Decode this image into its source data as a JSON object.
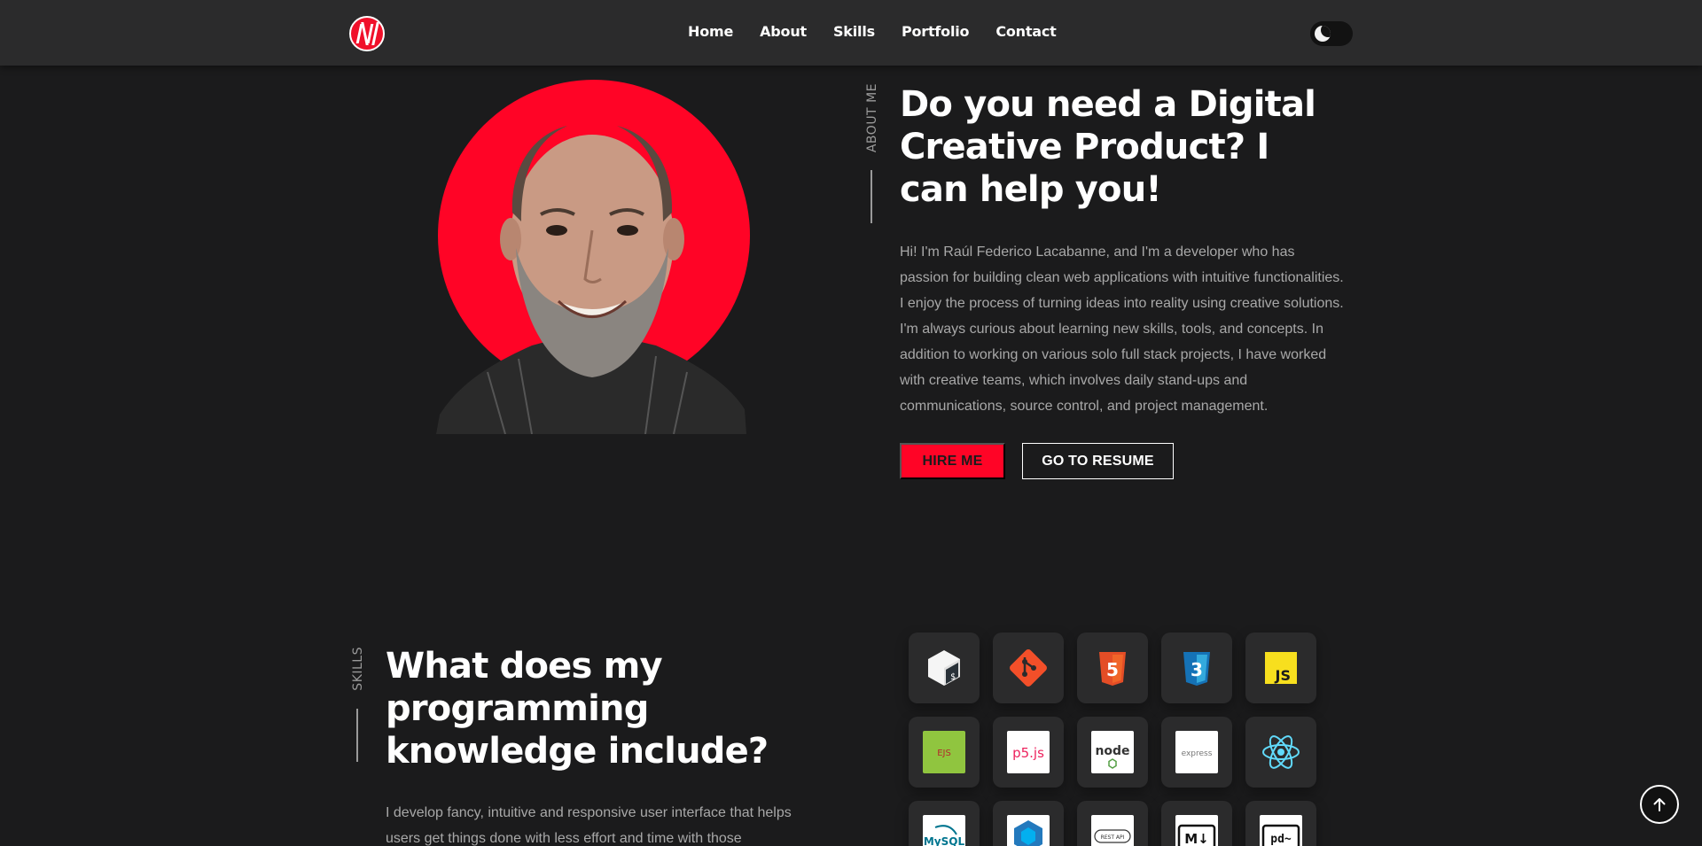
{
  "nav": {
    "links": [
      "Home",
      "About",
      "Skills",
      "Portfolio",
      "Contact"
    ],
    "logo_icon": "knw-logo-icon",
    "theme_toggle_icon": "moon-icon"
  },
  "about": {
    "section_tag": "ABOUT ME",
    "title": "Do you need a Digital Creative Product? I can help you!",
    "text": "Hi! I'm Raúl Federico Lacabanne, and I'm a developer who has passion for building clean web applications with intuitive functionalities. I enjoy the process of turning ideas into reality using creative solutions. I'm always curious about learning new skills, tools, and concepts. In addition to working on various solo full stack projects, I have worked with creative teams, which involves daily stand-ups and communications, source control, and project management.",
    "hire_label": "HIRE ME",
    "resume_label": "GO TO RESUME"
  },
  "skills": {
    "section_tag": "SKILLS",
    "title": "What does my programming knowledge include?",
    "text": "I develop fancy, intuitive and responsive user interface that helps users get things done with less effort and time with those",
    "icons": [
      "bash-icon",
      "git-icon",
      "html5-icon",
      "css3-icon",
      "javascript-icon",
      "ejs-icon",
      "p5js-icon",
      "nodejs-icon",
      "express-icon",
      "react-icon",
      "mysql-icon",
      "sequelize-icon",
      "rest-api-icon",
      "markdown-icon",
      "pandoc-icon"
    ],
    "labels": {
      "js": "JS",
      "ejs": "EJS",
      "p5": "p5.js",
      "node": "node",
      "express": "express",
      "mysql": "MySQL",
      "rest": "REST API",
      "md": "M↓",
      "pd": "pd~"
    }
  },
  "colors": {
    "accent": "#ff0426",
    "background": "#1b1b1c",
    "navbar": "#2b2b2c"
  },
  "scroll_top_icon": "arrow-up-icon"
}
